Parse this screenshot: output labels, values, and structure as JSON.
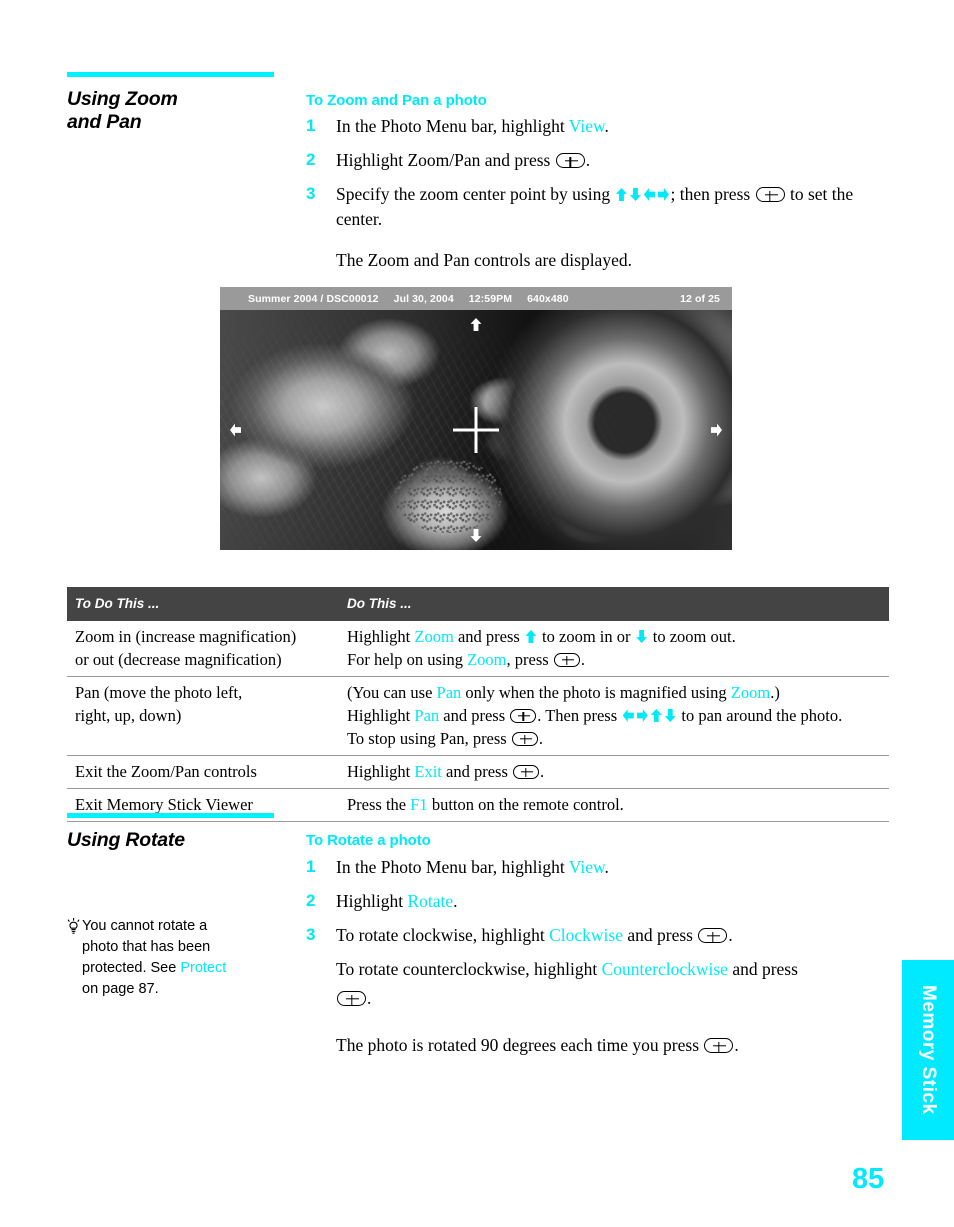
{
  "sections": [
    {
      "id": "zoom-pan",
      "title_line1": "Using Zoom",
      "title_line2": "and Pan",
      "subhead": "To Zoom and Pan a photo",
      "steps": [
        {
          "num": "1",
          "pre": "In the Photo Menu bar, highlight ",
          "link": "View",
          "post": "."
        },
        {
          "num": "2",
          "pre": "Highlight Zoom/Pan and press ",
          "post": "."
        },
        {
          "num": "3",
          "pre": "Specify the zoom center point by using ",
          "mid": "; then press ",
          "post": " to set the center."
        }
      ],
      "result": "The Zoom and Pan controls are displayed."
    },
    {
      "id": "rotate",
      "title_line1": "Using Rotate",
      "title_line2": "",
      "subhead": "To Rotate a photo",
      "steps": [
        {
          "num": "1",
          "pre": "In the Photo Menu bar, highlight ",
          "link": "View",
          "post": "."
        },
        {
          "num": "2",
          "pre": "Highlight ",
          "link": "Rotate",
          "post": "."
        },
        {
          "num": "3",
          "pre": "To rotate clockwise, highlight ",
          "link": "Clockwise",
          "post": " and press "
        }
      ],
      "step3_line2_pre": "To rotate counterclockwise, highlight ",
      "step3_line2_link": "Counterclockwise",
      "step3_line2_post": " and press",
      "result": "The photo is rotated 90 degrees each time you press "
    }
  ],
  "screenshot": {
    "album": "Summer 2004  /  DSC00012",
    "date": "Jul 30, 2004",
    "time": "12:59PM",
    "resolution": "640x480",
    "counter": "12 of 25"
  },
  "table": {
    "header": {
      "col1": "To Do This ...",
      "col2": "Do This ..."
    },
    "rows": [
      {
        "col1_lines": [
          "Zoom in (increase magnification)",
          "or out (decrease magnification)"
        ],
        "col2_line1": {
          "pre": "Highlight ",
          "link": "Zoom",
          "mid": " and press ",
          "mid2": " to zoom in or ",
          "post": " to zoom out."
        },
        "col2_line2": {
          "pre": "For help on using ",
          "link": "Zoom",
          "post": ", press "
        }
      },
      {
        "col1_lines": [
          "Pan (move the photo left,",
          "right, up, down)"
        ],
        "col2_line1": {
          "pre": "(You can use ",
          "link": "Pan",
          "mid": " only when the photo is magnified using ",
          "link2": "Zoom",
          "post": ".)"
        },
        "col2_line2": {
          "pre": "Highlight ",
          "link": "Pan",
          "mid": " and press ",
          "mid2": ". Then press ",
          "post": " to pan around the photo."
        },
        "col2_line3": {
          "pre": "To stop using Pan, press ",
          "post": "."
        }
      },
      {
        "col1_lines": [
          "Exit the Zoom/Pan controls"
        ],
        "col2_line1": {
          "pre": "Highlight ",
          "link": "Exit",
          "mid": " and press ",
          "post": "."
        }
      },
      {
        "col1_lines": [
          "Exit Memory Stick Viewer"
        ],
        "col2_line1": {
          "pre": "Press the ",
          "link": "F1",
          "mid": " button on the remote control.",
          "post": ""
        }
      }
    ]
  },
  "tip": {
    "line1": "You cannot rotate a",
    "line2": "photo that has been",
    "line3_pre": "protected. See ",
    "line3_link": "Protect",
    "line4": "on page 87."
  },
  "side_tab": {
    "label": "Memory Stick"
  },
  "page_number": "85",
  "colors": {
    "accent_cyan": "#00eaff",
    "table_header": "#444444",
    "info_bar": "#9a9a9a"
  }
}
